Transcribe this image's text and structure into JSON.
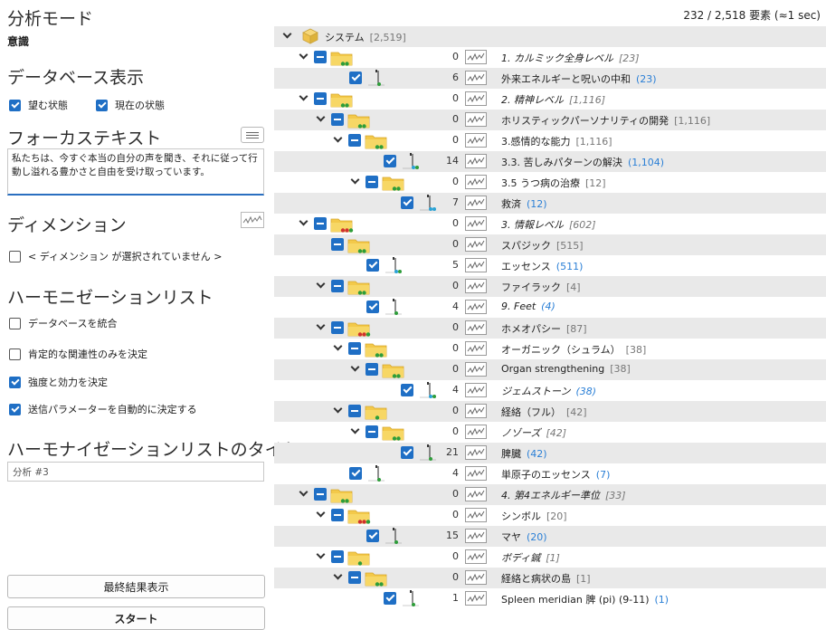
{
  "left_panel": {
    "analysis_mode_title": "分析モード",
    "analysis_mode_value": "意識",
    "db_display_title": "データベース表示",
    "desired_state_label": "望む状態",
    "current_state_label": "現在の状態",
    "focus_text_title": "フォーカステキスト",
    "focus_text_value": "私たちは、今すぐ本当の自分の声を聞き、それに従って行動し溢れる豊かさと自由を受け取っています。",
    "dimension_title": "ディメンション",
    "dimension_none_label": "< ディメンション が選択されていません >",
    "harmonization_list_title": "ハーモニゼーションリスト",
    "integrate_db_label": "データベースを統合",
    "positive_only_label": "肯定的な関連性のみを決定",
    "strength_label": "強度と効力を決定",
    "auto_params_label": "送信パラメーターを自動的に決定する",
    "list_title_heading": "ハーモナイゼーションリストのタイトル",
    "list_title_value": "分析 #3",
    "final_result_button": "最終結果表示",
    "start_button": "スタート"
  },
  "checkbox_states": {
    "desired_state": true,
    "current_state": true,
    "dimension": false,
    "integrate_db": false,
    "positive_only": false,
    "strength": true,
    "auto_params": true
  },
  "tree": {
    "element_count": "232 / 2,518 要素 (≈1 sec)",
    "root": {
      "label": "システム",
      "count": "[2,519]"
    },
    "rows": [
      {
        "num": "0",
        "label": "1. カルミック全身レベル",
        "count": "[23]"
      },
      {
        "num": "6",
        "label": "外来エネルギーと呪いの中和",
        "count": "(23)"
      },
      {
        "num": "0",
        "label": "2. 精神レベル",
        "count": "[1,116]"
      },
      {
        "num": "0",
        "label": "ホリスティックパーソナリティの開発",
        "count": "[1,116]"
      },
      {
        "num": "0",
        "label": "3.感情的な能力",
        "count": "[1,116]"
      },
      {
        "num": "14",
        "label": "3.3. 苦しみパターンの解決",
        "count": "(1,104)"
      },
      {
        "num": "0",
        "label": "3.5 うつ病の治療",
        "count": "[12]"
      },
      {
        "num": "7",
        "label": "救済",
        "count": "(12)"
      },
      {
        "num": "0",
        "label": "3. 情報レベル",
        "count": "[602]"
      },
      {
        "num": "0",
        "label": "スパジック",
        "count": "[515]"
      },
      {
        "num": "5",
        "label": "エッセンス",
        "count": "(511)"
      },
      {
        "num": "0",
        "label": "ファイラック",
        "count": "[4]"
      },
      {
        "num": "4",
        "label": "9. Feet",
        "count": "(4)"
      },
      {
        "num": "0",
        "label": "ホメオパシー",
        "count": "[87]"
      },
      {
        "num": "0",
        "label": "オーガニック（シュラム）",
        "count": "[38]"
      },
      {
        "num": "0",
        "label": "Organ strengthening",
        "count": "[38]"
      },
      {
        "num": "4",
        "label": "ジェムストーン",
        "count": "(38)"
      },
      {
        "num": "0",
        "label": "経絡（フル）",
        "count": "[42]"
      },
      {
        "num": "0",
        "label": "ノゾーズ",
        "count": "[42]"
      },
      {
        "num": "21",
        "label": "脾臓",
        "count": "(42)"
      },
      {
        "num": "4",
        "label": "単原子のエッセンス",
        "count": "(7)"
      },
      {
        "num": "0",
        "label": "4. 第4エネルギー準位",
        "count": "[33]"
      },
      {
        "num": "0",
        "label": "シンボル",
        "count": "[20]"
      },
      {
        "num": "15",
        "label": "マヤ",
        "count": "(20)"
      },
      {
        "num": "0",
        "label": "ボディ鍼",
        "count": "[1]"
      },
      {
        "num": "0",
        "label": "経絡と病状の島",
        "count": "[1]"
      },
      {
        "num": "1",
        "label": "Spleen meridian 脾 (pi) (9-11)",
        "count": "(1)"
      }
    ]
  }
}
